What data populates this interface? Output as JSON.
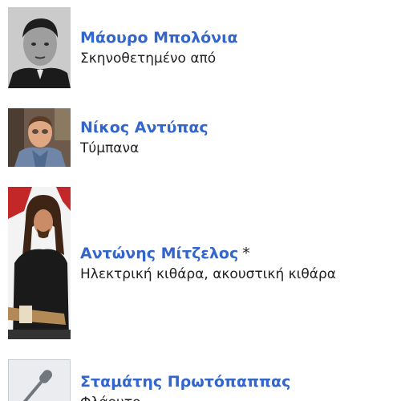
{
  "credits": [
    {
      "name": "Μάουρο Μπολόνια",
      "mark": "",
      "role": "Σκηνοθετημένο από",
      "photo": "portrait-man-bw"
    },
    {
      "name": "Νίκος Αντύπας",
      "mark": "",
      "role": "Τύμπανα",
      "photo": "portrait-man-drummer"
    },
    {
      "name": "Αντώνης Μίτζελος",
      "mark": "*",
      "role": "Ηλεκτρική κιθάρα, ακουστική κιθάρα",
      "photo": "portrait-guitarist"
    },
    {
      "name": "Σταμάτης Πρωτόπαππας",
      "mark": "",
      "role": "Φλάουτο",
      "photo": "microphone-placeholder-icon"
    }
  ]
}
